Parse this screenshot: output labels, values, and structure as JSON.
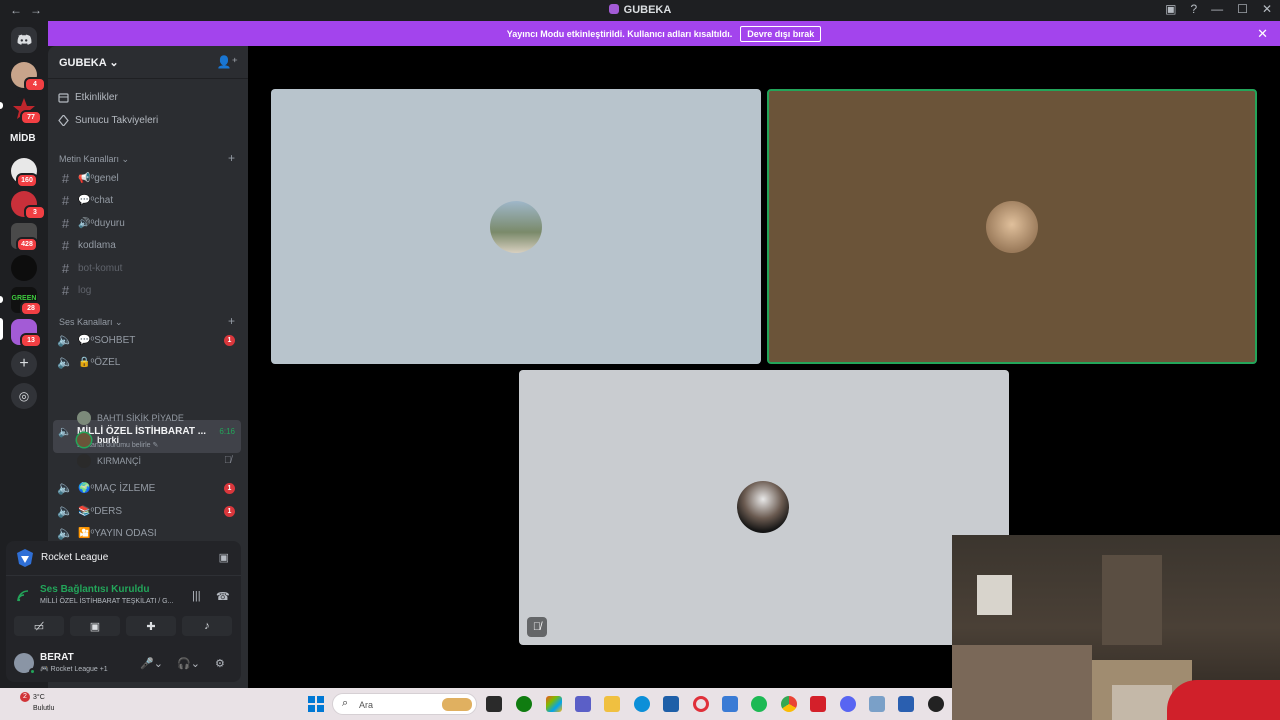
{
  "window": {
    "title": "GUBEKA"
  },
  "banner": {
    "text": "Yayıncı Modu etkinleştirildi. Kullanıcı adları kısaltıldı.",
    "button": "Devre dışı bırak",
    "close": "✕"
  },
  "rail": {
    "badges": [
      "4",
      "77",
      "160",
      "3",
      "428",
      "28",
      "13"
    ],
    "midb_label": "MİDB"
  },
  "server": {
    "name": "GUBEKA",
    "chevron": "⌄"
  },
  "nav": {
    "events": "Etkinlikler",
    "boosts": "Sunucu Takviyeleri"
  },
  "text_category": {
    "label": "Metin Kanalları"
  },
  "text_channels": [
    {
      "label": "📢ᵒgenel"
    },
    {
      "label": "💬ᵒchat"
    },
    {
      "label": "🔊ᵒduyuru"
    },
    {
      "label": "kodlama"
    },
    {
      "label": "bot-komut"
    },
    {
      "label": "log"
    }
  ],
  "voice_category": {
    "label": "Ses Kanalları"
  },
  "voice_channels_top": [
    {
      "label": "💬ᵒSOHBET",
      "unread": "1"
    },
    {
      "label": "🔒ᵒÖZEL",
      "unread": ""
    }
  ],
  "active_channel": {
    "label": "MİLLİ ÖZEL İSTİHBARAT ...",
    "time": "6:16",
    "status": "Bir kanal durumu belirle"
  },
  "voice_users": [
    {
      "name": "BAHTI SİKİK PİYADE"
    },
    {
      "name": "burki"
    },
    {
      "name": "KIRMANÇİ"
    }
  ],
  "voice_channels_bottom": [
    {
      "label": "🌍ᵒMAÇ İZLEME",
      "unread": "1"
    },
    {
      "label": "📚ᵒDERS",
      "unread": "1"
    },
    {
      "label": "🎦ᵒYAYIN ODASI",
      "unread": ""
    }
  ],
  "activity": {
    "name": "Rocket League"
  },
  "voice_connection": {
    "status": "Ses Bağlantısı Kuruldu",
    "channel": "MİLLİ ÖZEL İSTİHBARAT TEŞKİLATI / G..."
  },
  "user": {
    "name": "BERAT",
    "activity": "Rocket League +1"
  },
  "taskbar": {
    "temp": "3°C",
    "condition": "Bulutlu",
    "notif": "2",
    "search_placeholder": "Ara"
  },
  "colors": {
    "banner": "#a344ed",
    "connected_green": "#23a55a",
    "tile1": "#b8c4cc",
    "tile2": "#6b5439",
    "tile3": "#c9ccd0"
  }
}
